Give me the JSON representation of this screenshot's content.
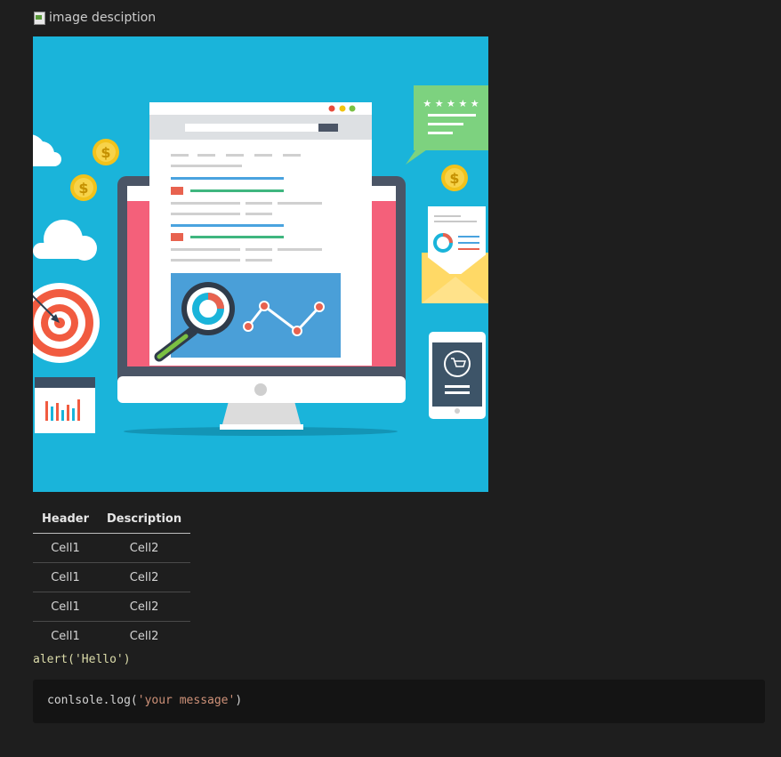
{
  "page": {
    "background": "#1e1e1e"
  },
  "broken_image": {
    "alt_text": "image desciption",
    "icon": "broken-image-icon"
  },
  "hero_image": {
    "description_icon": "web-analytics-illustration",
    "background_color": "#1ab4da",
    "rating_stars": "★ ★ ★ ★ ★",
    "coin_symbol": "$"
  },
  "table": {
    "headers": [
      "Header",
      "Description"
    ],
    "rows": [
      [
        "Cell1",
        "Cell2"
      ],
      [
        "Cell1",
        "Cell2"
      ],
      [
        "Cell1",
        "Cell2"
      ],
      [
        "Cell1",
        "Cell2"
      ]
    ]
  },
  "inline_code": {
    "text": "alert('Hello')",
    "color": "#dcdcaa"
  },
  "code_block": {
    "prefix": "conlsole.log(",
    "string": "'your message'",
    "suffix": ")",
    "string_color": "#ce9178"
  }
}
